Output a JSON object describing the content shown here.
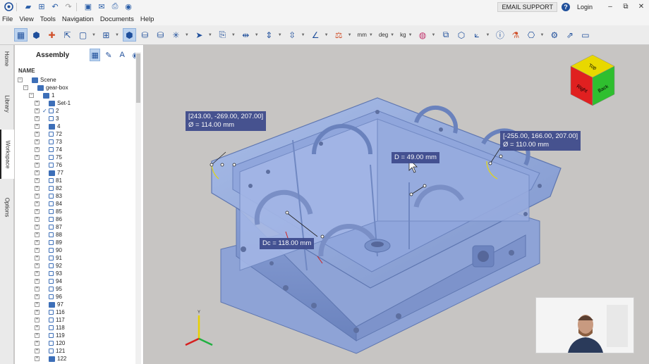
{
  "menu": [
    "File",
    "View",
    "Tools",
    "Navigation",
    "Documents",
    "Help"
  ],
  "titlebar": {
    "email_support": "EMAIL SUPPORT",
    "help": "?",
    "login": "Login",
    "minimize": "–",
    "restore": "⧉",
    "close": "✕"
  },
  "toolbar": {
    "units": [
      "mm",
      "deg",
      "kg"
    ]
  },
  "sidetabs": [
    "Home",
    "Library",
    "Workspace",
    "Options"
  ],
  "panel": {
    "title": "Assembly",
    "column": "NAME"
  },
  "tree": [
    {
      "label": "Scene",
      "level": 0,
      "icon": "folder"
    },
    {
      "label": "gear-box",
      "level": 1,
      "icon": "folder"
    },
    {
      "label": "1",
      "level": 2,
      "icon": "folder"
    },
    {
      "label": "Set-1",
      "level": 3,
      "icon": "pin"
    },
    {
      "label": "2",
      "level": 3,
      "icon": "lock",
      "checked": true
    },
    {
      "label": "3",
      "level": 3,
      "icon": "lock"
    },
    {
      "label": "4",
      "level": 3,
      "icon": "folder"
    },
    {
      "label": "72",
      "level": 3,
      "icon": "lock"
    },
    {
      "label": "73",
      "level": 3,
      "icon": "lock"
    },
    {
      "label": "74",
      "level": 3,
      "icon": "lock"
    },
    {
      "label": "75",
      "level": 3,
      "icon": "lock"
    },
    {
      "label": "76",
      "level": 3,
      "icon": "lock"
    },
    {
      "label": "77",
      "level": 3,
      "icon": "folder"
    },
    {
      "label": "81",
      "level": 3,
      "icon": "lock"
    },
    {
      "label": "82",
      "level": 3,
      "icon": "lock"
    },
    {
      "label": "83",
      "level": 3,
      "icon": "lock"
    },
    {
      "label": "84",
      "level": 3,
      "icon": "lock"
    },
    {
      "label": "85",
      "level": 3,
      "icon": "lock"
    },
    {
      "label": "86",
      "level": 3,
      "icon": "lock"
    },
    {
      "label": "87",
      "level": 3,
      "icon": "lock"
    },
    {
      "label": "88",
      "level": 3,
      "icon": "lock"
    },
    {
      "label": "89",
      "level": 3,
      "icon": "lock"
    },
    {
      "label": "90",
      "level": 3,
      "icon": "lock"
    },
    {
      "label": "91",
      "level": 3,
      "icon": "lock"
    },
    {
      "label": "92",
      "level": 3,
      "icon": "lock"
    },
    {
      "label": "93",
      "level": 3,
      "icon": "lock"
    },
    {
      "label": "94",
      "level": 3,
      "icon": "lock"
    },
    {
      "label": "95",
      "level": 3,
      "icon": "lock"
    },
    {
      "label": "96",
      "level": 3,
      "icon": "lock"
    },
    {
      "label": "97",
      "level": 3,
      "icon": "folder"
    },
    {
      "label": "116",
      "level": 3,
      "icon": "lock"
    },
    {
      "label": "117",
      "level": 3,
      "icon": "lock"
    },
    {
      "label": "118",
      "level": 3,
      "icon": "lock"
    },
    {
      "label": "119",
      "level": 3,
      "icon": "lock"
    },
    {
      "label": "120",
      "level": 3,
      "icon": "lock"
    },
    {
      "label": "121",
      "level": 3,
      "icon": "lock"
    },
    {
      "label": "122",
      "level": 3,
      "icon": "folder"
    }
  ],
  "measurements": {
    "m1_coord": "[243.00, -269.00, 207.00]",
    "m1_dia": "Ø = 114.00 mm",
    "m2_coord": "[-255.00, 166.00, 207.00]",
    "m2_dia": "Ø = 110.00 mm",
    "m3": "D = 49.00 mm",
    "m4": "Dc = 118.00 mm"
  },
  "viewcube": {
    "top": "Top",
    "right": "Back",
    "left": "Right",
    "colors": {
      "top": "#e8d800",
      "left": "#e02020",
      "right": "#2fbf2f"
    }
  },
  "triad": {
    "y_label": "Y",
    "colors": {
      "x": "#d62020",
      "y": "#e8d000",
      "z": "#20b040"
    }
  },
  "accent": "#3d4a8c"
}
